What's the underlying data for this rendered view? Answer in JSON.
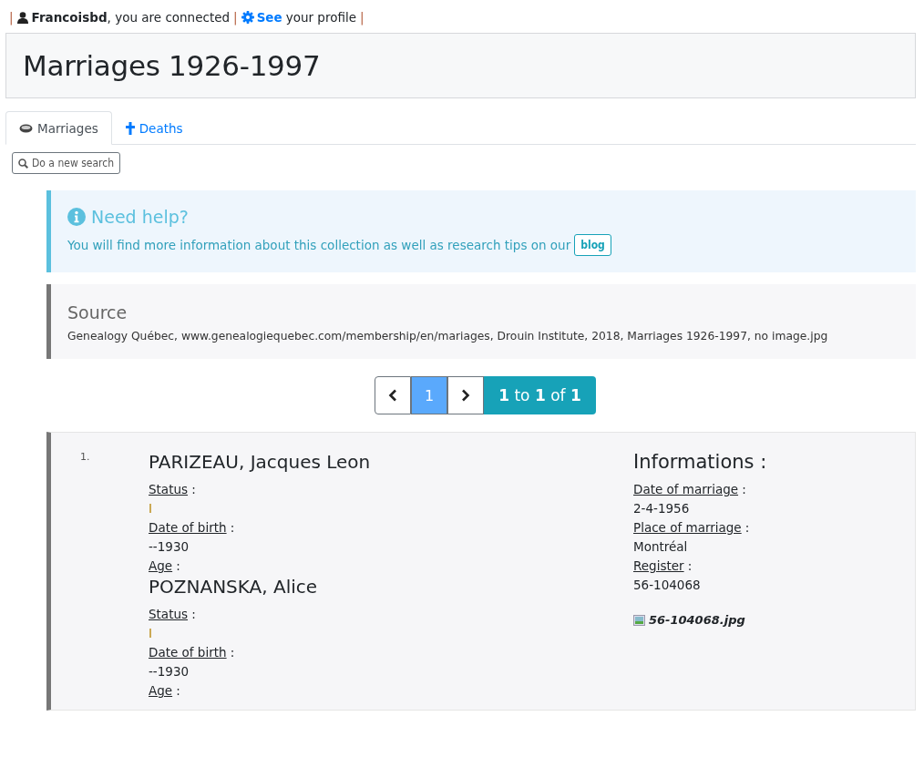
{
  "user_bar": {
    "separators": [
      "|",
      "|",
      "|"
    ],
    "username": "Francoisbd",
    "connected_text": ", you are connected",
    "see_link": "See",
    "profile_text": "your profile"
  },
  "title": "Marriages 1926-1997",
  "tabs": [
    {
      "label": "Marriages",
      "kind": "ring",
      "selected": true
    },
    {
      "label": "Deaths",
      "kind": "cross",
      "selected": false
    }
  ],
  "new_search_button": "Do a new search",
  "help": {
    "title": "Need help?",
    "text": "You will find more information about this collection as well as research tips on our",
    "link": "blog"
  },
  "source": {
    "title": "Source",
    "text": "Genealogy Québec, www.genealogiequebec.com/membership/en/mariages, Drouin Institute, 2018, Marriages 1926-1997, no image.jpg"
  },
  "pagination": {
    "pages": [
      {
        "label": "1",
        "selected": true
      }
    ],
    "summary": "**1** to **1** of **1**"
  },
  "record": {
    "number": "1.",
    "persons": [
      {
        "name": "PARIZEAU, Jacques Leon",
        "fields": [
          {
            "label": "Status",
            "colon": ":",
            "value": "I",
            "kind": "status"
          },
          {
            "label": "Date of birth",
            "colon": ":",
            "value": "--1930",
            "kind": "plain"
          },
          {
            "label": "Age",
            "colon": ":"
          }
        ]
      },
      {
        "name": "POZNANSKA, Alice",
        "fields": [
          {
            "label": "Status",
            "colon": ":",
            "value": "I",
            "kind": "status"
          },
          {
            "label": "Date of birth",
            "colon": ":",
            "value": "--1930",
            "kind": "plain"
          },
          {
            "label": "Age",
            "colon": ":"
          }
        ]
      }
    ],
    "info": {
      "title": "Informations :",
      "fields": [
        {
          "label": "Date of marriage",
          "colon": ":",
          "value": "2-4-1956"
        },
        {
          "label": "Place of marriage",
          "colon": ":",
          "value": "Montréal"
        },
        {
          "label": "Register",
          "colon": ":",
          "value": "56-104068"
        }
      ],
      "image_file": "56-104068.jpg"
    }
  }
}
